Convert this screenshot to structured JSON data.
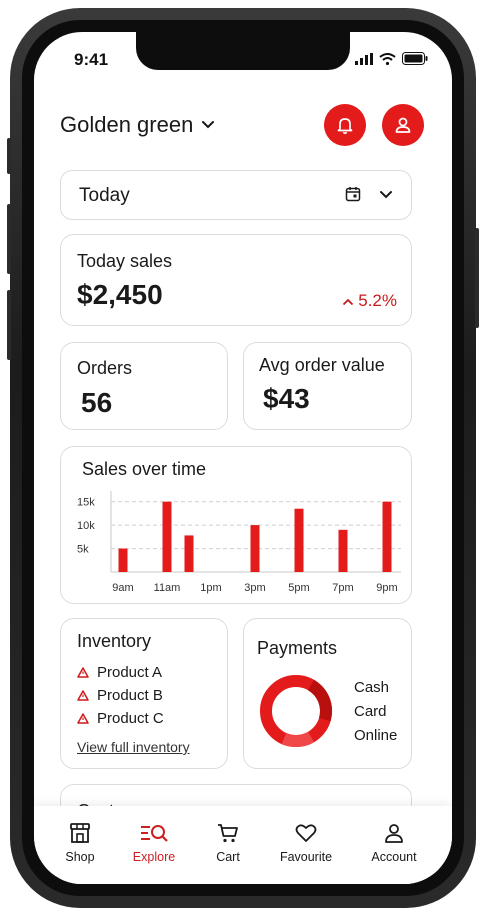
{
  "status": {
    "time": "9:41"
  },
  "header": {
    "store_name": "Golden green"
  },
  "date_selector": {
    "value": "Today"
  },
  "today_sales": {
    "title": "Today sales",
    "value": "$2,450",
    "delta": "5.2%"
  },
  "orders": {
    "title": "Orders",
    "value": "56"
  },
  "avg_order": {
    "title": "Avg order value",
    "value": "$43"
  },
  "sales_chart": {
    "title": "Sales over time"
  },
  "chart_data": {
    "type": "bar",
    "title": "Sales over time",
    "categories": [
      "9am",
      "",
      "11am",
      "",
      "1pm",
      "",
      "3pm",
      "",
      "5pm",
      "",
      "7pm",
      "",
      "9pm"
    ],
    "values": [
      5000,
      15000,
      7800,
      10000,
      13500,
      9000,
      15000
    ],
    "bar_times": [
      "9am",
      "11am",
      "12pm",
      "3pm",
      "5pm",
      "7pm",
      "9pm"
    ],
    "ytick_labels": [
      "15k",
      "10k",
      "5k"
    ],
    "yticks": [
      15000,
      10000,
      5000
    ],
    "xtick_labels": [
      "9am",
      "11am",
      "1pm",
      "3pm",
      "5pm",
      "7pm",
      "9pm"
    ],
    "ylim": [
      0,
      16000
    ],
    "grid": true,
    "color": "#e31b1b"
  },
  "inventory": {
    "title": "Inventory",
    "items": [
      "Product A",
      "Product B",
      "Product C"
    ],
    "link": "View full inventory"
  },
  "payments": {
    "title": "Payments",
    "legend": [
      "Cash",
      "Card",
      "Online"
    ]
  },
  "customers": {
    "title": "Customers"
  },
  "tabbar": {
    "items": [
      {
        "label": "Shop",
        "icon": "shop-icon"
      },
      {
        "label": "Explore",
        "icon": "explore-icon",
        "active": true
      },
      {
        "label": "Cart",
        "icon": "cart-icon"
      },
      {
        "label": "Favourite",
        "icon": "heart-icon"
      },
      {
        "label": "Account",
        "icon": "account-icon"
      }
    ]
  },
  "colors": {
    "accent": "#e31b1b",
    "delta": "#cc1a1a"
  }
}
